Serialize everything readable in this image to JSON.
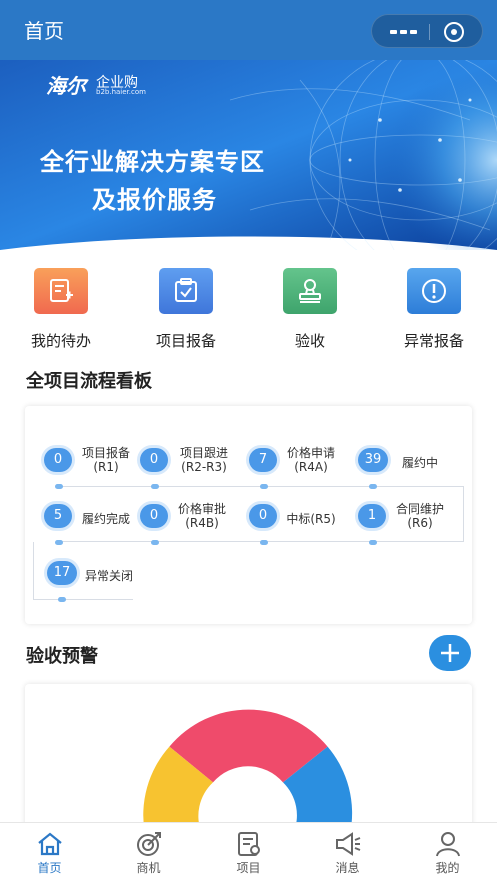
{
  "topbar": {
    "title": "首页"
  },
  "banner": {
    "logo_text": "海尔",
    "logo_sub": "企业购",
    "logo_url": "b2b.haier.com",
    "headline_1": "全行业解决方案专区",
    "headline_2": "及报价服务"
  },
  "quick_actions": [
    {
      "label": "我的待办",
      "icon": "todo-edit-icon",
      "color": "#f27b5f"
    },
    {
      "label": "项目报备",
      "icon": "clipboard-check-icon",
      "color": "#4a89e6"
    },
    {
      "label": "验收",
      "icon": "stamp-icon",
      "color": "#4cb07a"
    },
    {
      "label": "异常报备",
      "icon": "alert-circle-icon",
      "color": "#3f8de0"
    }
  ],
  "flow_board": {
    "title": "全项目流程看板",
    "nodes": [
      {
        "count": "0",
        "name": "项目报备\n(R1)"
      },
      {
        "count": "0",
        "name": "项目跟进(R2-R3)"
      },
      {
        "count": "7",
        "name": "价格申请\n(R4A)"
      },
      {
        "count": "39",
        "name": "履约中"
      },
      {
        "count": "5",
        "name": "履约完成"
      },
      {
        "count": "0",
        "name": "价格审批\n(R4B)"
      },
      {
        "count": "0",
        "name": "中标(R5)"
      },
      {
        "count": "1",
        "name": "合同维护\n(R6)"
      },
      {
        "count": "17",
        "name": "异常关闭"
      }
    ]
  },
  "acceptance": {
    "title": "验收预警",
    "chart_colors": [
      "#ef4b6b",
      "#2b8fe0",
      "#f7c330"
    ]
  },
  "tabbar": [
    {
      "label": "首页",
      "icon": "home-icon",
      "active": true
    },
    {
      "label": "商机",
      "icon": "target-icon",
      "active": false
    },
    {
      "label": "项目",
      "icon": "document-icon",
      "active": false
    },
    {
      "label": "消息",
      "icon": "megaphone-icon",
      "active": false
    },
    {
      "label": "我的",
      "icon": "user-icon",
      "active": false
    }
  ]
}
